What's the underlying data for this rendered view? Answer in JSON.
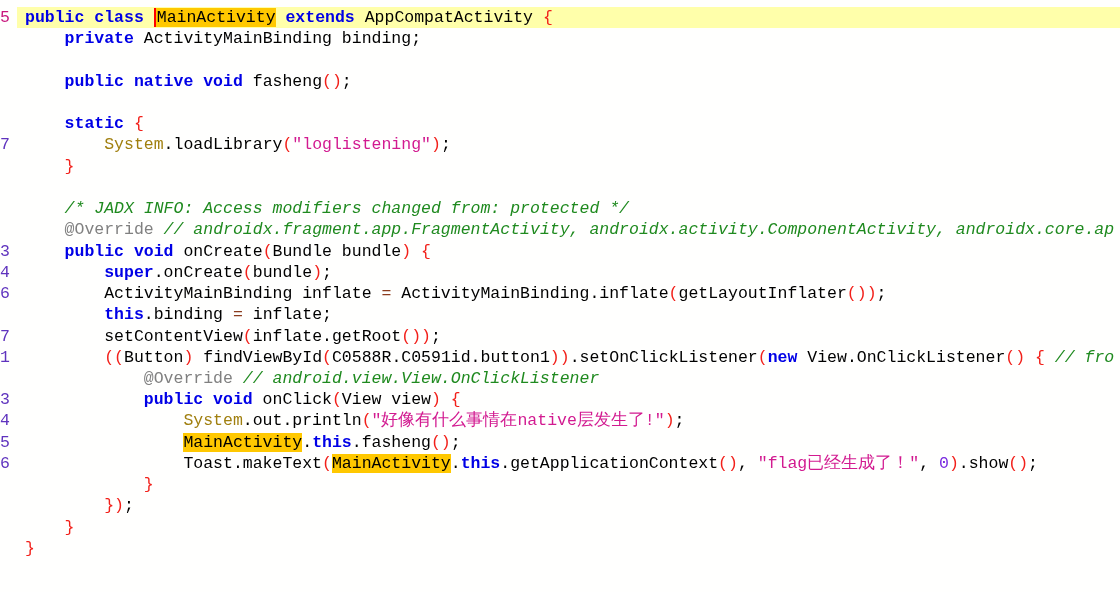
{
  "editor": {
    "lines": [
      {
        "kind": "code",
        "number": "5",
        "current": true,
        "tokens": [
          {
            "kind": "keyword",
            "text": "public class "
          },
          {
            "kind": "match",
            "text": "MainActivity",
            "cursor": true
          },
          {
            "kind": "keyword",
            "text": " extends"
          },
          {
            "kind": "plain",
            "text": " AppCompatActivity "
          },
          {
            "kind": "paren",
            "text": "{"
          }
        ],
        "children": [
          {
            "kind": "code",
            "current": false,
            "tokens": [
              {
                "kind": "keyword",
                "text": "private"
              },
              {
                "kind": "plain",
                "text": " ActivityMainBinding binding;"
              }
            ]
          },
          {
            "kind": "blank"
          },
          {
            "kind": "code",
            "current": false,
            "tokens": [
              {
                "kind": "keyword",
                "text": "public native void"
              },
              {
                "kind": "plain",
                "text": " fasheng"
              },
              {
                "kind": "paren",
                "text": "()"
              },
              {
                "kind": "plain",
                "text": ";"
              }
            ]
          },
          {
            "kind": "blank"
          },
          {
            "kind": "code",
            "current": false,
            "tokens": [
              {
                "kind": "keyword",
                "text": "static"
              },
              {
                "kind": "paren",
                "text": " {"
              }
            ],
            "children": [
              {
                "kind": "code",
                "number": "7",
                "current": false,
                "tokens": [
                  {
                    "kind": "type",
                    "text": "System"
                  },
                  {
                    "kind": "plain",
                    "text": ".loadLibrary"
                  },
                  {
                    "kind": "paren",
                    "text": "("
                  },
                  {
                    "kind": "string",
                    "text": "\"loglistening\""
                  },
                  {
                    "kind": "paren",
                    "text": ")"
                  },
                  {
                    "kind": "plain",
                    "text": ";"
                  }
                ]
              }
            ]
          },
          {
            "kind": "code",
            "current": false,
            "tokens": [
              {
                "kind": "paren",
                "text": "}"
              }
            ]
          },
          {
            "kind": "blank"
          },
          {
            "kind": "code",
            "current": false,
            "tokens": [
              {
                "kind": "comment",
                "text": "/* JADX INFO: Access modifiers changed from: protected */"
              }
            ]
          },
          {
            "kind": "code",
            "current": false,
            "tokens": [
              {
                "kind": "annotation",
                "text": "@Override"
              },
              {
                "kind": "comment",
                "text": " // androidx.fragment.app.FragmentActivity, androidx.activity.ComponentActivity, androidx.core.ap"
              }
            ]
          },
          {
            "kind": "code",
            "number": "3",
            "current": false,
            "tokens": [
              {
                "kind": "keyword",
                "text": "public void"
              },
              {
                "kind": "plain",
                "text": " onCreate"
              },
              {
                "kind": "paren",
                "text": "("
              },
              {
                "kind": "plain",
                "text": "Bundle bundle"
              },
              {
                "kind": "paren",
                "text": ") {"
              }
            ],
            "children": [
              {
                "kind": "code",
                "number": "4",
                "current": false,
                "tokens": [
                  {
                    "kind": "keyword",
                    "text": "super"
                  },
                  {
                    "kind": "plain",
                    "text": ".onCreate"
                  },
                  {
                    "kind": "paren",
                    "text": "("
                  },
                  {
                    "kind": "plain",
                    "text": "bundle"
                  },
                  {
                    "kind": "paren",
                    "text": ")"
                  },
                  {
                    "kind": "plain",
                    "text": ";"
                  }
                ]
              },
              {
                "kind": "code",
                "number": "6",
                "current": false,
                "tokens": [
                  {
                    "kind": "plain",
                    "text": "ActivityMainBinding inflate "
                  },
                  {
                    "kind": "operator",
                    "text": "="
                  },
                  {
                    "kind": "plain",
                    "text": " ActivityMainBinding.inflate"
                  },
                  {
                    "kind": "paren",
                    "text": "("
                  },
                  {
                    "kind": "plain",
                    "text": "getLayoutInflater"
                  },
                  {
                    "kind": "paren",
                    "text": "())"
                  },
                  {
                    "kind": "plain",
                    "text": ";"
                  }
                ]
              },
              {
                "kind": "code",
                "current": false,
                "tokens": [
                  {
                    "kind": "keyword",
                    "text": "this"
                  },
                  {
                    "kind": "plain",
                    "text": ".binding "
                  },
                  {
                    "kind": "operator",
                    "text": "="
                  },
                  {
                    "kind": "plain",
                    "text": " inflate;"
                  }
                ]
              },
              {
                "kind": "code",
                "number": "7",
                "current": false,
                "tokens": [
                  {
                    "kind": "plain",
                    "text": "setContentView"
                  },
                  {
                    "kind": "paren",
                    "text": "("
                  },
                  {
                    "kind": "plain",
                    "text": "inflate.getRoot"
                  },
                  {
                    "kind": "paren",
                    "text": "())"
                  },
                  {
                    "kind": "plain",
                    "text": ";"
                  }
                ]
              },
              {
                "kind": "code",
                "number": "1",
                "current": false,
                "tokens": [
                  {
                    "kind": "paren",
                    "text": "(("
                  },
                  {
                    "kind": "plain",
                    "text": "Button"
                  },
                  {
                    "kind": "paren",
                    "text": ")"
                  },
                  {
                    "kind": "plain",
                    "text": " findViewById"
                  },
                  {
                    "kind": "paren",
                    "text": "("
                  },
                  {
                    "kind": "plain",
                    "text": "C0588R.C0591id.button1"
                  },
                  {
                    "kind": "paren",
                    "text": "))"
                  },
                  {
                    "kind": "plain",
                    "text": ".setOnClickListener"
                  },
                  {
                    "kind": "paren",
                    "text": "("
                  },
                  {
                    "kind": "keyword",
                    "text": "new"
                  },
                  {
                    "kind": "plain",
                    "text": " View.OnClickListener"
                  },
                  {
                    "kind": "paren",
                    "text": "() {"
                  },
                  {
                    "kind": "comment",
                    "text": " // fro"
                  }
                ],
                "children": [
                  {
                    "kind": "code",
                    "current": false,
                    "tokens": [
                      {
                        "kind": "annotation",
                        "text": "@Override"
                      },
                      {
                        "kind": "comment",
                        "text": " // android.view.View.OnClickListener"
                      }
                    ]
                  },
                  {
                    "kind": "code",
                    "number": "3",
                    "current": false,
                    "tokens": [
                      {
                        "kind": "keyword",
                        "text": "public void"
                      },
                      {
                        "kind": "plain",
                        "text": " onClick"
                      },
                      {
                        "kind": "paren",
                        "text": "("
                      },
                      {
                        "kind": "plain",
                        "text": "View view"
                      },
                      {
                        "kind": "paren",
                        "text": ") {"
                      }
                    ],
                    "children": [
                      {
                        "kind": "code",
                        "number": "4",
                        "current": false,
                        "tokens": [
                          {
                            "kind": "type",
                            "text": "System"
                          },
                          {
                            "kind": "plain",
                            "text": ".out.println"
                          },
                          {
                            "kind": "paren",
                            "text": "("
                          },
                          {
                            "kind": "string",
                            "text": "\"好像有什么事情在native层发生了!\""
                          },
                          {
                            "kind": "paren",
                            "text": ")"
                          },
                          {
                            "kind": "plain",
                            "text": ";"
                          }
                        ]
                      },
                      {
                        "kind": "code",
                        "number": "5",
                        "current": false,
                        "tokens": [
                          {
                            "kind": "match",
                            "text": "MainActivity",
                            "cursor": false
                          },
                          {
                            "kind": "plain",
                            "text": "."
                          },
                          {
                            "kind": "keyword",
                            "text": "this"
                          },
                          {
                            "kind": "plain",
                            "text": ".fasheng"
                          },
                          {
                            "kind": "paren",
                            "text": "()"
                          },
                          {
                            "kind": "plain",
                            "text": ";"
                          }
                        ]
                      },
                      {
                        "kind": "code",
                        "number": "6",
                        "current": false,
                        "tokens": [
                          {
                            "kind": "plain",
                            "text": "Toast.makeText"
                          },
                          {
                            "kind": "paren",
                            "text": "("
                          },
                          {
                            "kind": "match",
                            "text": "MainActivity",
                            "cursor": false
                          },
                          {
                            "kind": "plain",
                            "text": "."
                          },
                          {
                            "kind": "keyword",
                            "text": "this"
                          },
                          {
                            "kind": "plain",
                            "text": ".getApplicationContext"
                          },
                          {
                            "kind": "paren",
                            "text": "()"
                          },
                          {
                            "kind": "plain",
                            "text": ", "
                          },
                          {
                            "kind": "string",
                            "text": "\"flag已经生成了！\""
                          },
                          {
                            "kind": "plain",
                            "text": ", "
                          },
                          {
                            "kind": "number",
                            "text": "0"
                          },
                          {
                            "kind": "paren",
                            "text": ")"
                          },
                          {
                            "kind": "plain",
                            "text": ".show"
                          },
                          {
                            "kind": "paren",
                            "text": "()"
                          },
                          {
                            "kind": "plain",
                            "text": ";"
                          }
                        ]
                      }
                    ]
                  },
                  {
                    "kind": "code",
                    "current": false,
                    "tokens": [
                      {
                        "kind": "paren",
                        "text": "}"
                      }
                    ]
                  }
                ]
              },
              {
                "kind": "code",
                "current": false,
                "tokens": [
                  {
                    "kind": "paren",
                    "text": "})"
                  },
                  {
                    "kind": "plain",
                    "text": ";"
                  }
                ]
              }
            ]
          },
          {
            "kind": "code",
            "current": false,
            "tokens": [
              {
                "kind": "paren",
                "text": "}"
              }
            ]
          }
        ]
      },
      {
        "kind": "code",
        "current": false,
        "tokens": [
          {
            "kind": "paren",
            "text": "}"
          }
        ]
      }
    ]
  }
}
